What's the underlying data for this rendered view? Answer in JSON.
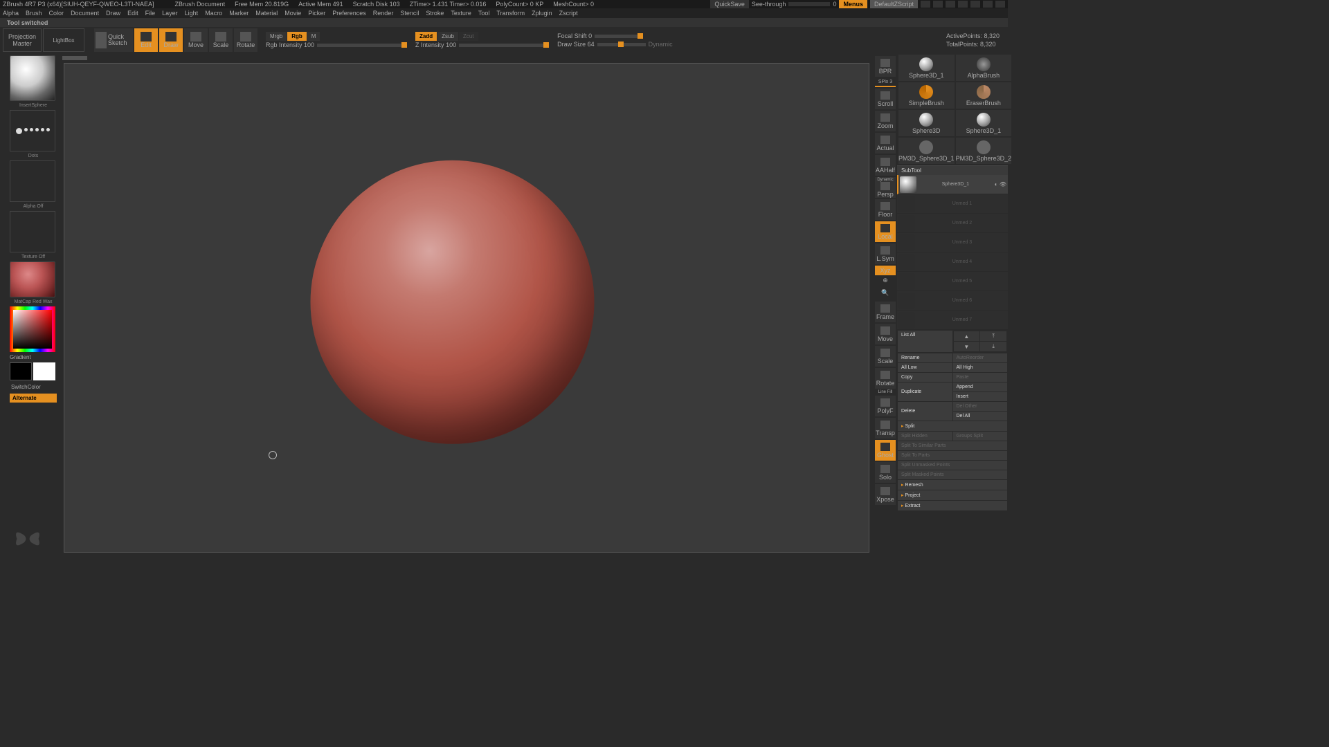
{
  "titlebar": {
    "app": "ZBrush 4R7 P3 (x64)[SIUH-QEYF-QWEO-L3TI-NAEA]",
    "doc": "ZBrush Document",
    "stats": [
      "Free Mem 20.819G",
      "Active Mem 491",
      "Scratch Disk 103",
      "ZTime> 1.431 Timer> 0.016",
      "PolyCount> 0 KP",
      "MeshCount> 0"
    ],
    "quicksave": "QuickSave",
    "seethrough": "See-through",
    "seethrough_val": "0",
    "menus": "Menus",
    "script": "DefaultZScript"
  },
  "menubar": [
    "Alpha",
    "Brush",
    "Color",
    "Document",
    "Draw",
    "Edit",
    "File",
    "Layer",
    "Light",
    "Macro",
    "Marker",
    "Material",
    "Movie",
    "Picker",
    "Preferences",
    "Render",
    "Stencil",
    "Stroke",
    "Texture",
    "Tool",
    "Transform",
    "Zplugin",
    "Zscript"
  ],
  "status": "Tool switched",
  "toolbar": {
    "projection": "Projection\nMaster",
    "lightbox": "LightBox",
    "quicksketch": "Quick\nSketch",
    "edit": "Edit",
    "draw": "Draw",
    "move": "Move",
    "scale": "Scale",
    "rotate": "Rotate",
    "mrgb": "Mrgb",
    "rgb": "Rgb",
    "m": "M",
    "rgb_intensity": "Rgb Intensity 100",
    "zadd": "Zadd",
    "zsub": "Zsub",
    "zcut": "Zcut",
    "z_intensity": "Z Intensity 100",
    "focal": "Focal Shift 0",
    "drawsize": "Draw Size 64",
    "dynamic": "Dynamic",
    "active_points": "ActivePoints: 8,320",
    "total_points": "TotalPoints: 8,320"
  },
  "leftbar": {
    "brush": "InsertSphere",
    "stroke": "Dots",
    "alpha": "Alpha Off",
    "texture": "Texture Off",
    "material": "MatCap Red Wax",
    "gradient": "Gradient",
    "switchcolor": "SwitchColor",
    "alternate": "Alternate"
  },
  "rightnav": {
    "bpr": "BPR",
    "spix": "SPix 3",
    "scroll": "Scroll",
    "zoom": "Zoom",
    "actual": "Actual",
    "aahalf": "AAHalf",
    "persp": "Persp",
    "floor": "Floor",
    "local": "Local",
    "lsym": "L.Sym",
    "xyz": "Xyz",
    "frame": "Frame",
    "move": "Move",
    "scale": "Scale",
    "rotate": "Rotate",
    "linefill": "Line Fill",
    "polyf": "PolyF",
    "transp": "Transp",
    "ghost": "Ghost",
    "solo": "Solo",
    "xpose": "Xpose",
    "dynamic": "Dynamic"
  },
  "presets": {
    "p0": "Sphere3D_1",
    "p1": "AlphaBrush",
    "p2": "SimpleBrush",
    "p3": "EraserBrush",
    "p4": "Sphere3D",
    "p5": "Sphere3D_1",
    "p6": "PM3D_Sphere3D_1",
    "p7": "PM3D_Sphere3D_2"
  },
  "subtool": {
    "header": "SubTool",
    "item0": "Sphere3D_1",
    "dimmed": [
      "Unmed 1",
      "Unmed 2",
      "Unmed 3",
      "Unmed 4",
      "Unmed 5",
      "Unmed 6",
      "Unmed 7"
    ],
    "list_all": "List All"
  },
  "buttons": {
    "rename": "Rename",
    "autoreorder": "AutoReorder",
    "all_low": "All Low",
    "all_high": "All High",
    "copy": "Copy",
    "paste": "Paste",
    "append": "Append",
    "duplicate": "Duplicate",
    "insert": "Insert",
    "delete": "Delete",
    "del_other": "Del Other",
    "del_all": "Del All",
    "split": "Split",
    "split_hidden": "Split Hidden",
    "groups_split": "Groups Split",
    "split_similar": "Split To Similar Parts",
    "split_parts": "Split To Parts",
    "split_unmasked": "Split Unmasked Points",
    "split_masked": "Split Masked Points",
    "remesh": "Remesh",
    "project": "Project",
    "extract": "Extract"
  }
}
